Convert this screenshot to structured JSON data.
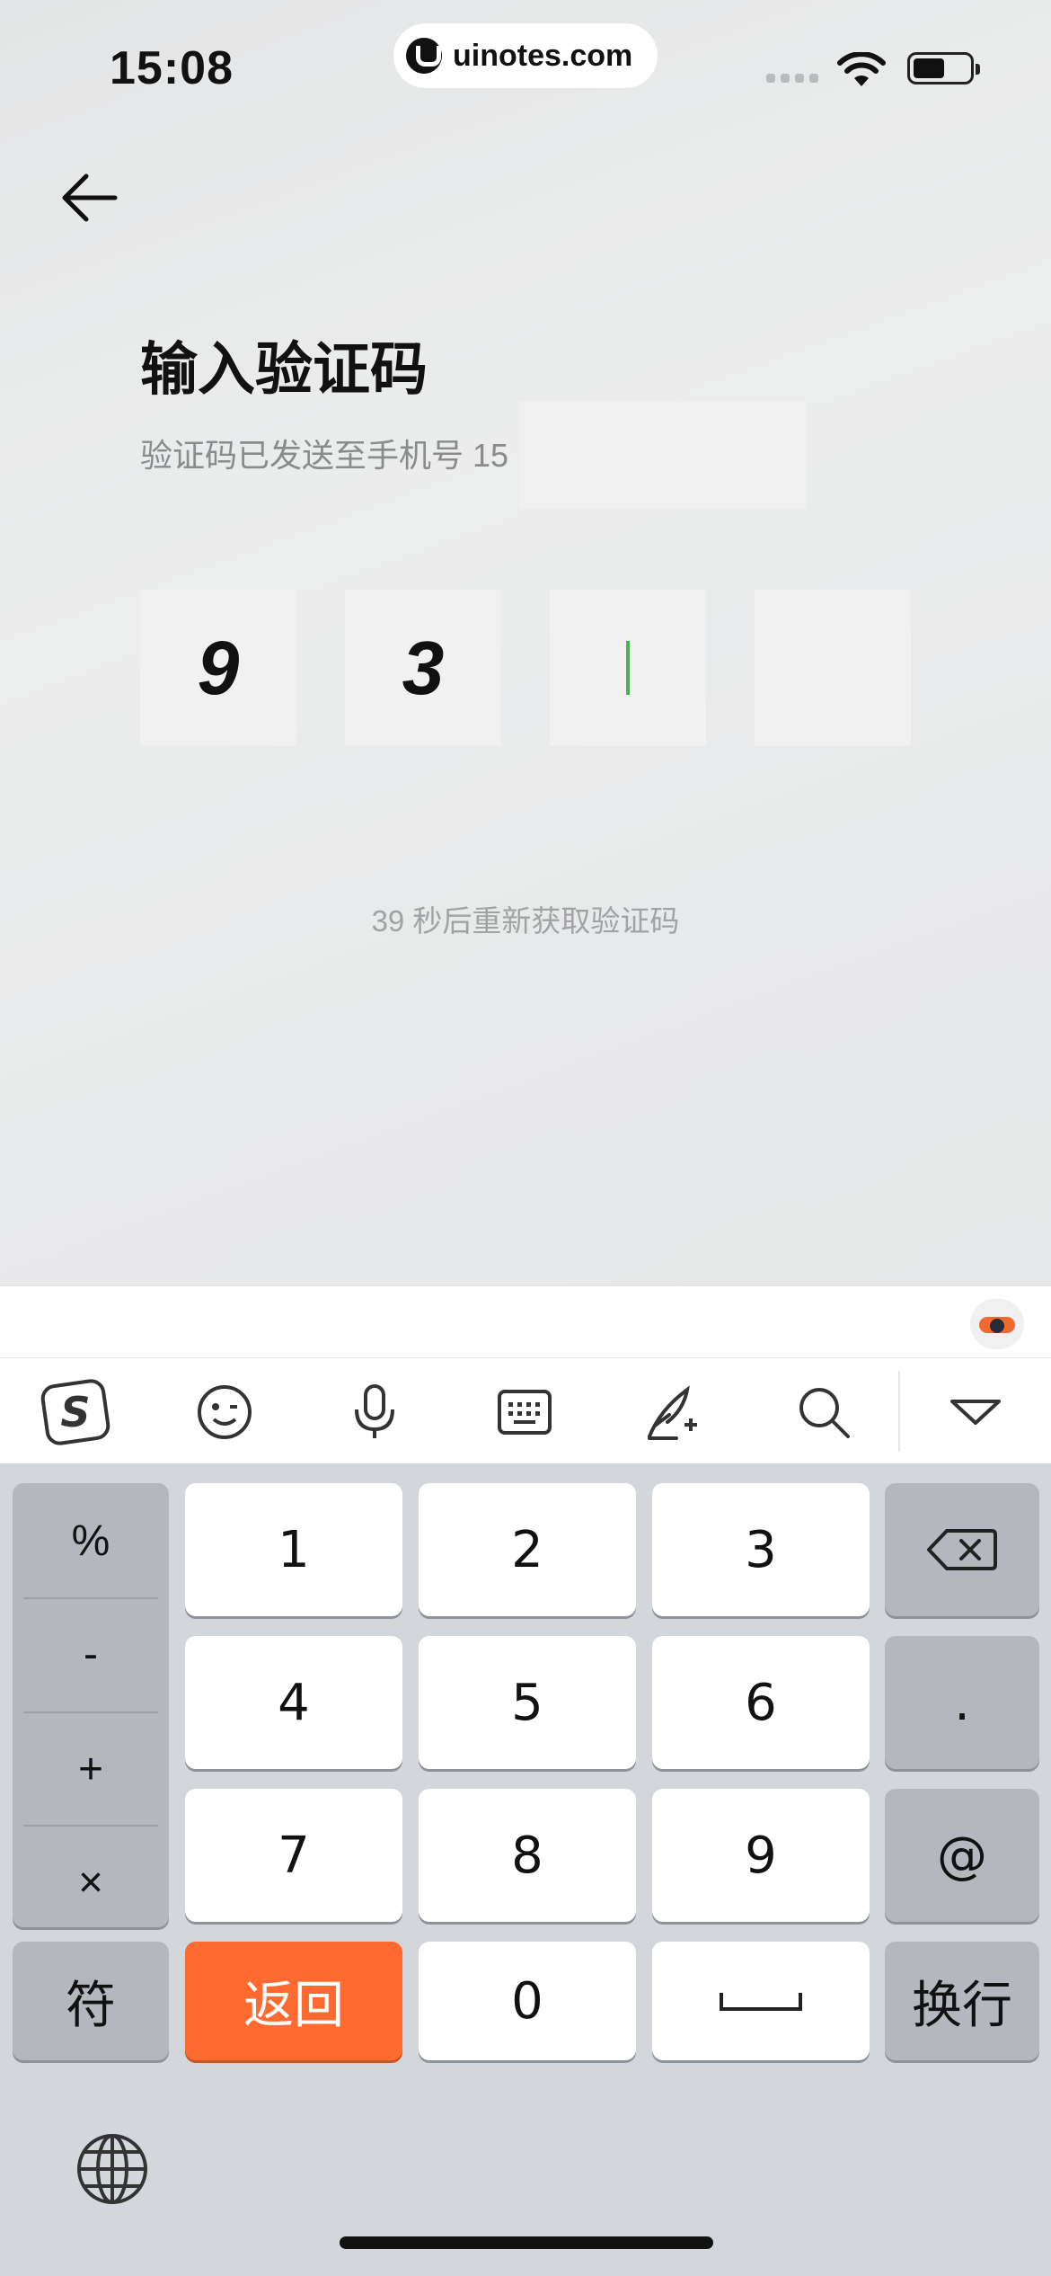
{
  "status": {
    "time": "15:08",
    "site": "uinotes.com"
  },
  "page": {
    "title": "输入验证码",
    "subtitle": "验证码已发送至手机号 15",
    "code_digits": [
      "9",
      "3",
      "",
      ""
    ],
    "resend_text": "39 秒后重新获取验证码"
  },
  "keyboard": {
    "toolbar_icons": [
      "sogou-logo-icon",
      "emoji-icon",
      "microphone-icon",
      "keyboard-icon",
      "handwriting-icon",
      "search-icon",
      "collapse-keyboard-icon"
    ],
    "symbols": [
      "%",
      "-",
      "+",
      "×"
    ],
    "digits": [
      "1",
      "2",
      "3",
      "4",
      "5",
      "6",
      "7",
      "8",
      "9",
      "0"
    ],
    "period": ".",
    "at": "@",
    "fu": "符",
    "back": "返回",
    "enter": "换行",
    "accent_color": "#fe6a30"
  }
}
